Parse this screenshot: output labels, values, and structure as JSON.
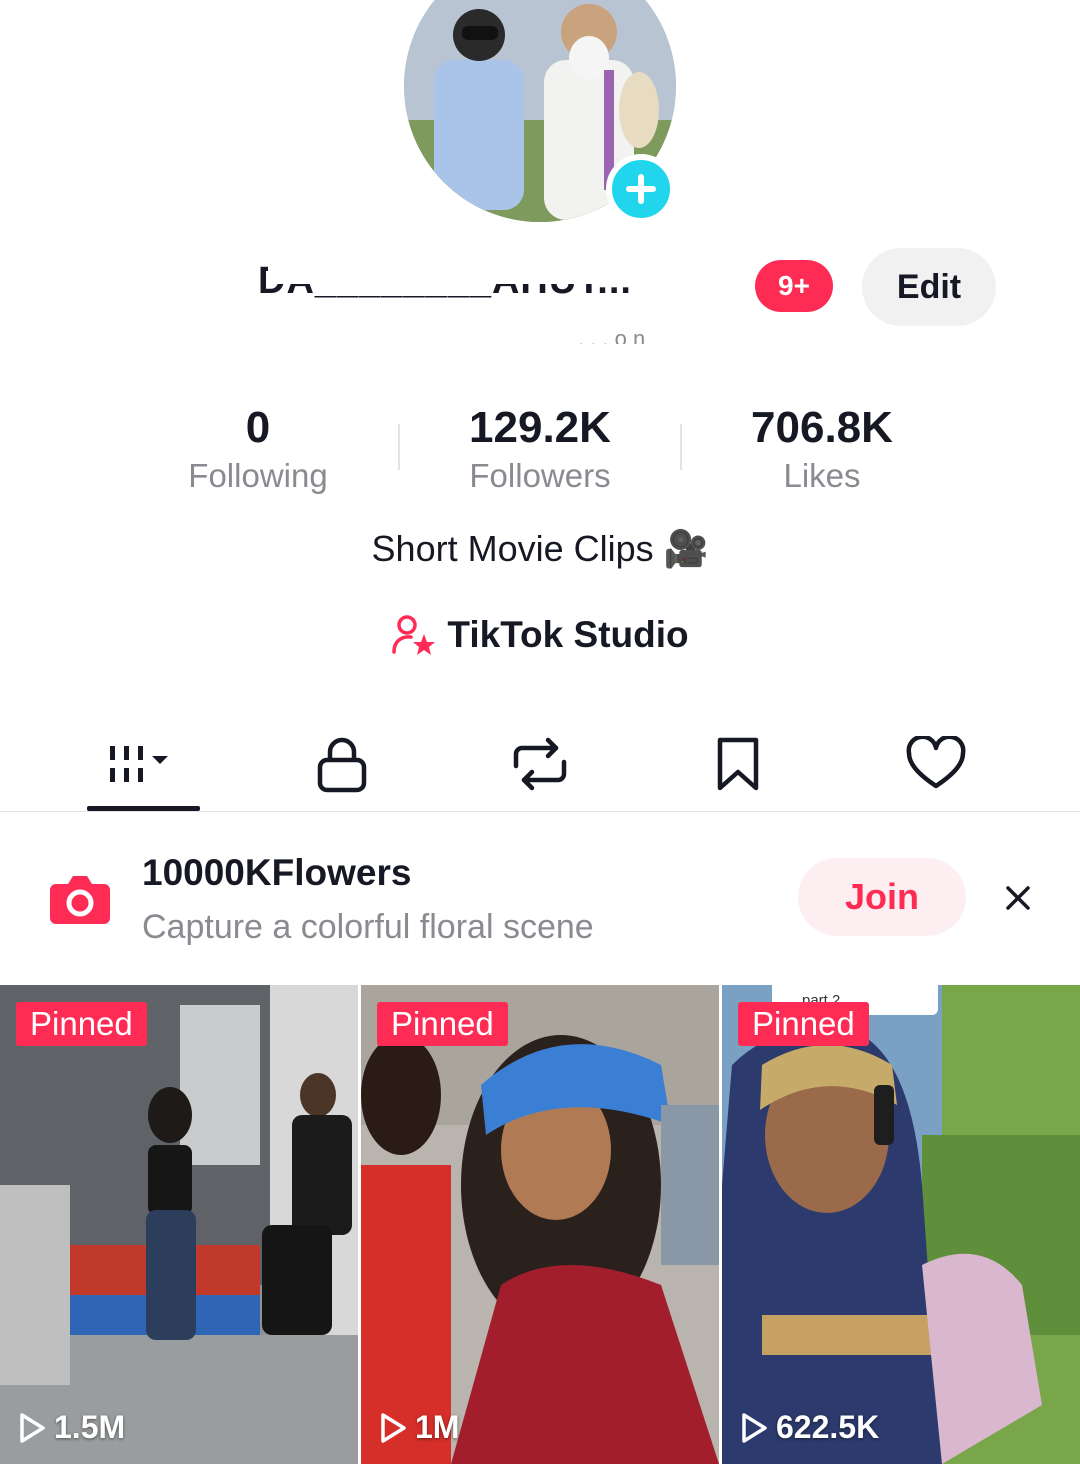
{
  "profile": {
    "username": "DA________AHUT...",
    "notification_badge": "9+",
    "edit_label": "Edit",
    "handle": ". . . o n",
    "bio": "Short Movie Clips 🎥",
    "studio_label": "TikTok Studio"
  },
  "stats": [
    {
      "value": "0",
      "label": "Following"
    },
    {
      "value": "129.2K",
      "label": "Followers"
    },
    {
      "value": "706.8K",
      "label": "Likes"
    }
  ],
  "tabs": [
    {
      "icon": "videos-grid-icon",
      "active": true
    },
    {
      "icon": "lock-icon",
      "active": false
    },
    {
      "icon": "repost-icon",
      "active": false
    },
    {
      "icon": "bookmark-icon",
      "active": false
    },
    {
      "icon": "heart-icon",
      "active": false
    }
  ],
  "challenge": {
    "title": "10000KFlowers",
    "subtitle": "Capture a colorful floral scene",
    "join_label": "Join"
  },
  "videos": [
    {
      "badge": "Pinned",
      "views": "1.5M"
    },
    {
      "badge": "Pinned",
      "views": "1M"
    },
    {
      "badge": "Pinned",
      "views": "622.5K",
      "tag": "part 2"
    }
  ],
  "colors": {
    "accent": "#fe2c55",
    "add_button": "#20d5ec",
    "text_primary": "#161823",
    "text_secondary": "#8a8b91"
  }
}
